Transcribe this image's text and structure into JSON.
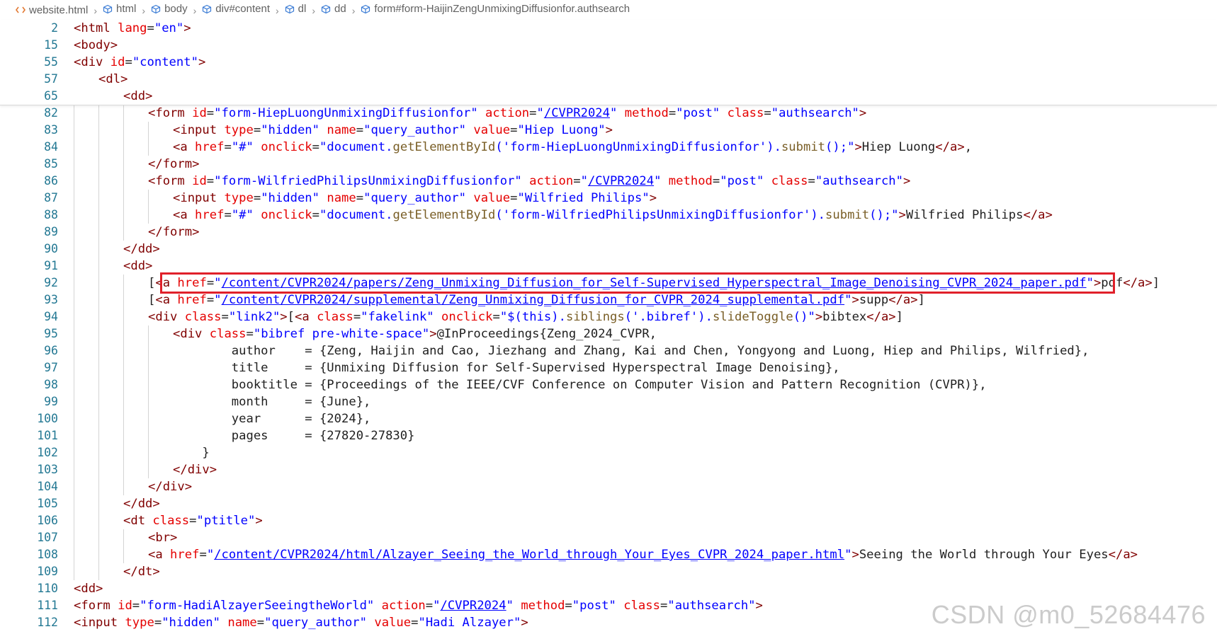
{
  "breadcrumb": {
    "file": "website.html",
    "items": [
      "html",
      "body",
      "div#content",
      "dl",
      "dd",
      "form#form-HaijinZengUnmixingDiffusionfor.authsearch"
    ]
  },
  "sticky_lines": [
    {
      "num": "2",
      "indent": 0,
      "tokens": [
        [
          "t",
          "<html "
        ],
        [
          "a",
          "lang"
        ],
        [
          "p",
          "="
        ],
        [
          "s",
          "\"en\""
        ],
        [
          "t",
          ">"
        ]
      ]
    },
    {
      "num": "15",
      "indent": 0,
      "tokens": [
        [
          "t",
          "<body>"
        ]
      ]
    },
    {
      "num": "55",
      "indent": 0,
      "tokens": [
        [
          "t",
          "<div "
        ],
        [
          "a",
          "id"
        ],
        [
          "p",
          "="
        ],
        [
          "s",
          "\"content\""
        ],
        [
          "t",
          ">"
        ]
      ]
    },
    {
      "num": "57",
      "indent": 1,
      "tokens": [
        [
          "t",
          "<dl>"
        ]
      ]
    },
    {
      "num": "65",
      "indent": 2,
      "tokens": [
        [
          "t",
          "<dd>"
        ]
      ]
    }
  ],
  "lines": [
    {
      "num": "82",
      "indent": 3,
      "tokens": [
        [
          "t",
          "<form "
        ],
        [
          "a",
          "id"
        ],
        [
          "p",
          "="
        ],
        [
          "s",
          "\"form-HiepLuongUnmixingDiffusionfor\""
        ],
        [
          "p",
          " "
        ],
        [
          "a",
          "action"
        ],
        [
          "p",
          "="
        ],
        [
          "s",
          "\""
        ],
        [
          "l",
          "/CVPR2024"
        ],
        [
          "s",
          "\""
        ],
        [
          "p",
          " "
        ],
        [
          "a",
          "method"
        ],
        [
          "p",
          "="
        ],
        [
          "s",
          "\"post\""
        ],
        [
          "p",
          " "
        ],
        [
          "a",
          "class"
        ],
        [
          "p",
          "="
        ],
        [
          "s",
          "\"authsearch\""
        ],
        [
          "t",
          ">"
        ]
      ]
    },
    {
      "num": "83",
      "indent": 4,
      "tokens": [
        [
          "t",
          "<input "
        ],
        [
          "a",
          "type"
        ],
        [
          "p",
          "="
        ],
        [
          "s",
          "\"hidden\""
        ],
        [
          "p",
          " "
        ],
        [
          "a",
          "name"
        ],
        [
          "p",
          "="
        ],
        [
          "s",
          "\"query_author\""
        ],
        [
          "p",
          " "
        ],
        [
          "a",
          "value"
        ],
        [
          "p",
          "="
        ],
        [
          "s",
          "\"Hiep Luong\""
        ],
        [
          "t",
          ">"
        ]
      ]
    },
    {
      "num": "84",
      "indent": 4,
      "tokens": [
        [
          "t",
          "<a "
        ],
        [
          "a",
          "href"
        ],
        [
          "p",
          "="
        ],
        [
          "s",
          "\"#\""
        ],
        [
          "p",
          " "
        ],
        [
          "a",
          "onclick"
        ],
        [
          "p",
          "="
        ],
        [
          "s",
          "\"document."
        ],
        [
          "f",
          "getElementById"
        ],
        [
          "s",
          "('form-HiepLuongUnmixingDiffusionfor')."
        ],
        [
          "f",
          "submit"
        ],
        [
          "s",
          "();\""
        ],
        [
          "t",
          ">"
        ],
        [
          "p",
          "Hiep Luong"
        ],
        [
          "t",
          "</a>"
        ],
        [
          "p",
          ","
        ]
      ]
    },
    {
      "num": "85",
      "indent": 3,
      "tokens": [
        [
          "t",
          "</form>"
        ]
      ]
    },
    {
      "num": "86",
      "indent": 3,
      "tokens": [
        [
          "t",
          "<form "
        ],
        [
          "a",
          "id"
        ],
        [
          "p",
          "="
        ],
        [
          "s",
          "\"form-WilfriedPhilipsUnmixingDiffusionfor\""
        ],
        [
          "p",
          " "
        ],
        [
          "a",
          "action"
        ],
        [
          "p",
          "="
        ],
        [
          "s",
          "\""
        ],
        [
          "l",
          "/CVPR2024"
        ],
        [
          "s",
          "\""
        ],
        [
          "p",
          " "
        ],
        [
          "a",
          "method"
        ],
        [
          "p",
          "="
        ],
        [
          "s",
          "\"post\""
        ],
        [
          "p",
          " "
        ],
        [
          "a",
          "class"
        ],
        [
          "p",
          "="
        ],
        [
          "s",
          "\"authsearch\""
        ],
        [
          "t",
          ">"
        ]
      ]
    },
    {
      "num": "87",
      "indent": 4,
      "tokens": [
        [
          "t",
          "<input "
        ],
        [
          "a",
          "type"
        ],
        [
          "p",
          "="
        ],
        [
          "s",
          "\"hidden\""
        ],
        [
          "p",
          " "
        ],
        [
          "a",
          "name"
        ],
        [
          "p",
          "="
        ],
        [
          "s",
          "\"query_author\""
        ],
        [
          "p",
          " "
        ],
        [
          "a",
          "value"
        ],
        [
          "p",
          "="
        ],
        [
          "s",
          "\"Wilfried Philips\""
        ],
        [
          "t",
          ">"
        ]
      ]
    },
    {
      "num": "88",
      "indent": 4,
      "tokens": [
        [
          "t",
          "<a "
        ],
        [
          "a",
          "href"
        ],
        [
          "p",
          "="
        ],
        [
          "s",
          "\"#\""
        ],
        [
          "p",
          " "
        ],
        [
          "a",
          "onclick"
        ],
        [
          "p",
          "="
        ],
        [
          "s",
          "\"document."
        ],
        [
          "f",
          "getElementById"
        ],
        [
          "s",
          "('form-WilfriedPhilipsUnmixingDiffusionfor')."
        ],
        [
          "f",
          "submit"
        ],
        [
          "s",
          "();\""
        ],
        [
          "t",
          ">"
        ],
        [
          "p",
          "Wilfried Philips"
        ],
        [
          "t",
          "</a>"
        ]
      ]
    },
    {
      "num": "89",
      "indent": 3,
      "tokens": [
        [
          "t",
          "</form>"
        ]
      ]
    },
    {
      "num": "90",
      "indent": 2,
      "tokens": [
        [
          "t",
          "</dd>"
        ]
      ]
    },
    {
      "num": "91",
      "indent": 2,
      "tokens": [
        [
          "t",
          "<dd>"
        ]
      ]
    },
    {
      "num": "92",
      "indent": 3,
      "tokens": [
        [
          "p",
          "["
        ],
        [
          "t",
          "<a "
        ],
        [
          "a",
          "href"
        ],
        [
          "p",
          "="
        ],
        [
          "s",
          "\""
        ],
        [
          "l",
          "/content/CVPR2024/papers/Zeng_Unmixing_Diffusion_for_Self-Supervised_Hyperspectral_Image_Denoising_CVPR_2024_paper.pdf"
        ],
        [
          "s",
          "\""
        ],
        [
          "t",
          ">"
        ],
        [
          "p",
          "pdf"
        ],
        [
          "t",
          "</a>"
        ],
        [
          "p",
          "]"
        ]
      ]
    },
    {
      "num": "93",
      "indent": 3,
      "tokens": [
        [
          "p",
          "["
        ],
        [
          "t",
          "<a "
        ],
        [
          "a",
          "href"
        ],
        [
          "p",
          "="
        ],
        [
          "s",
          "\""
        ],
        [
          "l",
          "/content/CVPR2024/supplemental/Zeng_Unmixing_Diffusion_for_CVPR_2024_supplemental.pdf"
        ],
        [
          "s",
          "\""
        ],
        [
          "t",
          ">"
        ],
        [
          "p",
          "supp"
        ],
        [
          "t",
          "</a>"
        ],
        [
          "p",
          "]"
        ]
      ]
    },
    {
      "num": "94",
      "indent": 3,
      "tokens": [
        [
          "t",
          "<div "
        ],
        [
          "a",
          "class"
        ],
        [
          "p",
          "="
        ],
        [
          "s",
          "\"link2\""
        ],
        [
          "t",
          ">"
        ],
        [
          "p",
          "["
        ],
        [
          "t",
          "<a "
        ],
        [
          "a",
          "class"
        ],
        [
          "p",
          "="
        ],
        [
          "s",
          "\"fakelink\""
        ],
        [
          "p",
          " "
        ],
        [
          "a",
          "onclick"
        ],
        [
          "p",
          "="
        ],
        [
          "s",
          "\"$(this)."
        ],
        [
          "f",
          "siblings"
        ],
        [
          "s",
          "('.bibref')."
        ],
        [
          "f",
          "slideToggle"
        ],
        [
          "s",
          "()\""
        ],
        [
          "t",
          ">"
        ],
        [
          "p",
          "bibtex"
        ],
        [
          "t",
          "</a>"
        ],
        [
          "p",
          "]"
        ]
      ]
    },
    {
      "num": "95",
      "indent": 4,
      "tokens": [
        [
          "t",
          "<div "
        ],
        [
          "a",
          "class"
        ],
        [
          "p",
          "="
        ],
        [
          "s",
          "\"bibref pre-white-space\""
        ],
        [
          "t",
          ">"
        ],
        [
          "p",
          "@InProceedings{Zeng_2024_CVPR,"
        ]
      ]
    },
    {
      "num": "96",
      "indent": 4,
      "tokens": [
        [
          "p",
          "        author    = {Zeng, Haijin and Cao, Jiezhang and Zhang, Kai and Chen, Yongyong and Luong, Hiep and Philips, Wilfried},"
        ]
      ]
    },
    {
      "num": "97",
      "indent": 4,
      "tokens": [
        [
          "p",
          "        title     = {Unmixing Diffusion for Self-Supervised Hyperspectral Image Denoising},"
        ]
      ]
    },
    {
      "num": "98",
      "indent": 4,
      "tokens": [
        [
          "p",
          "        booktitle = {Proceedings of the IEEE/CVF Conference on Computer Vision and Pattern Recognition (CVPR)},"
        ]
      ]
    },
    {
      "num": "99",
      "indent": 4,
      "tokens": [
        [
          "p",
          "        month     = {June},"
        ]
      ]
    },
    {
      "num": "100",
      "indent": 4,
      "tokens": [
        [
          "p",
          "        year      = {2024},"
        ]
      ]
    },
    {
      "num": "101",
      "indent": 4,
      "tokens": [
        [
          "p",
          "        pages     = {27820-27830}"
        ]
      ]
    },
    {
      "num": "102",
      "indent": 4,
      "tokens": [
        [
          "p",
          "    }"
        ]
      ]
    },
    {
      "num": "103",
      "indent": 4,
      "tokens": [
        [
          "t",
          "</div>"
        ]
      ]
    },
    {
      "num": "104",
      "indent": 3,
      "tokens": [
        [
          "t",
          "</div>"
        ]
      ]
    },
    {
      "num": "105",
      "indent": 2,
      "tokens": [
        [
          "t",
          "</dd>"
        ]
      ]
    },
    {
      "num": "106",
      "indent": 2,
      "tokens": [
        [
          "t",
          "<dt "
        ],
        [
          "a",
          "class"
        ],
        [
          "p",
          "="
        ],
        [
          "s",
          "\"ptitle\""
        ],
        [
          "t",
          ">"
        ]
      ]
    },
    {
      "num": "107",
      "indent": 3,
      "tokens": [
        [
          "t",
          "<br>"
        ]
      ]
    },
    {
      "num": "108",
      "indent": 3,
      "tokens": [
        [
          "t",
          "<a "
        ],
        [
          "a",
          "href"
        ],
        [
          "p",
          "="
        ],
        [
          "s",
          "\""
        ],
        [
          "l",
          "/content/CVPR2024/html/Alzayer_Seeing_the_World_through_Your_Eyes_CVPR_2024_paper.html"
        ],
        [
          "s",
          "\""
        ],
        [
          "t",
          ">"
        ],
        [
          "p",
          "Seeing the World through Your Eyes"
        ],
        [
          "t",
          "</a>"
        ]
      ]
    },
    {
      "num": "109",
      "indent": 2,
      "tokens": [
        [
          "t",
          "</dt>"
        ]
      ]
    },
    {
      "num": "110",
      "indent": 0,
      "tokens": [
        [
          "t",
          "<dd>"
        ]
      ]
    },
    {
      "num": "111",
      "indent": 0,
      "tokens": [
        [
          "t",
          "<form "
        ],
        [
          "a",
          "id"
        ],
        [
          "p",
          "="
        ],
        [
          "s",
          "\"form-HadiAlzayerSeeingtheWorld\""
        ],
        [
          "p",
          " "
        ],
        [
          "a",
          "action"
        ],
        [
          "p",
          "="
        ],
        [
          "s",
          "\""
        ],
        [
          "l",
          "/CVPR2024"
        ],
        [
          "s",
          "\""
        ],
        [
          "p",
          " "
        ],
        [
          "a",
          "method"
        ],
        [
          "p",
          "="
        ],
        [
          "s",
          "\"post\""
        ],
        [
          "p",
          " "
        ],
        [
          "a",
          "class"
        ],
        [
          "p",
          "="
        ],
        [
          "s",
          "\"authsearch\""
        ],
        [
          "t",
          ">"
        ]
      ]
    },
    {
      "num": "112",
      "indent": 0,
      "tokens": [
        [
          "t",
          "<input "
        ],
        [
          "a",
          "type"
        ],
        [
          "p",
          "="
        ],
        [
          "s",
          "\"hidden\""
        ],
        [
          "p",
          " "
        ],
        [
          "a",
          "name"
        ],
        [
          "p",
          "="
        ],
        [
          "s",
          "\"query_author\""
        ],
        [
          "p",
          " "
        ],
        [
          "a",
          "value"
        ],
        [
          "p",
          "="
        ],
        [
          "s",
          "\"Hadi Alzayer\""
        ],
        [
          "t",
          ">"
        ]
      ]
    }
  ],
  "highlighted_line": "92",
  "watermark": "CSDN @m0_52684476",
  "colors": {
    "tag": "#800000",
    "attribute": "#e50000",
    "string": "#0000ff",
    "function": "#795e26",
    "line_number": "#237893",
    "highlight_box": "#e0202a"
  }
}
